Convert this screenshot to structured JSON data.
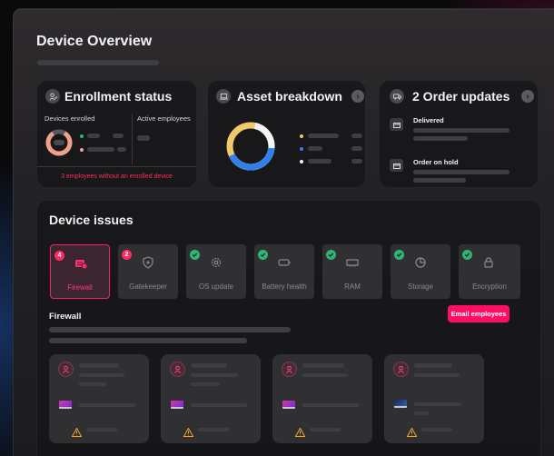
{
  "page": {
    "title": "Device Overview"
  },
  "enrollment": {
    "title": "Enrollment status",
    "icon": "user-check-icon",
    "col1_label": "Devices enrolled",
    "col2_label": "Active employees",
    "warning": "3 employees without an enrolled device",
    "colors": {
      "accent": "#ff2d5f",
      "donut_track": "#f0a08a",
      "donut_gap": "#5a5a5e"
    }
  },
  "assets": {
    "title": "Asset breakdown",
    "icon": "laptop-icon",
    "legend_colors": [
      "#f1c86a",
      "#2f80ed",
      "#f4f4f6"
    ]
  },
  "orders": {
    "title": "2 Order updates",
    "icon": "truck-icon",
    "items": [
      {
        "label": "Delivered",
        "icon": "box-icon"
      },
      {
        "label": "Order on hold",
        "icon": "box-icon"
      }
    ]
  },
  "issues": {
    "title": "Device issues",
    "tiles": [
      {
        "label": "Firewall",
        "badge": "4",
        "status": "error",
        "icon": "firewall-icon",
        "active": true
      },
      {
        "label": "Gatekeeper",
        "badge": "2",
        "status": "error",
        "icon": "shield-icon",
        "active": false
      },
      {
        "label": "OS update",
        "badge": "",
        "status": "ok",
        "icon": "gear-icon",
        "active": false
      },
      {
        "label": "Battery health",
        "badge": "",
        "status": "ok",
        "icon": "battery-icon",
        "active": false
      },
      {
        "label": "RAM",
        "badge": "",
        "status": "ok",
        "icon": "memory-icon",
        "active": false
      },
      {
        "label": "Storage",
        "badge": "",
        "status": "ok",
        "icon": "storage-icon",
        "active": false
      },
      {
        "label": "Encryption",
        "badge": "",
        "status": "ok",
        "icon": "lock-icon",
        "active": false
      }
    ],
    "section_title": "Firewall",
    "email_button": "Email employees",
    "employee_cards": 4
  }
}
